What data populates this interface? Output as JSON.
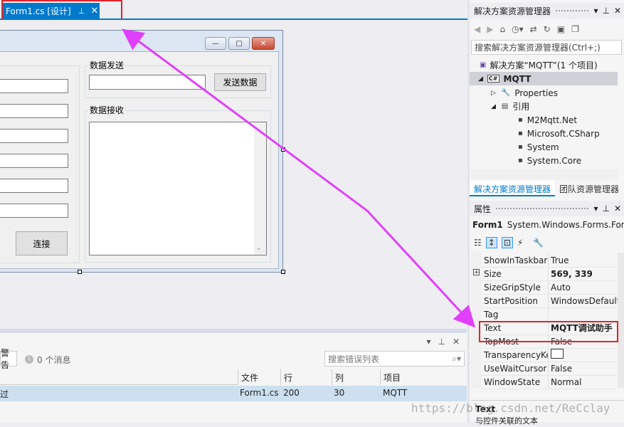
{
  "doc_tab": {
    "title": "Form1.cs [设计]",
    "pin": "⊥",
    "close": "✕"
  },
  "form_designer": {
    "groups": {
      "send": "数据发送",
      "receive": "数据接收"
    },
    "send_button": "发送数据",
    "connect_button": "连接",
    "caption_buttons": {
      "minimize": "—",
      "maximize": "□",
      "close": "✕"
    }
  },
  "solution_explorer": {
    "title": "解决方案资源管理器",
    "search_placeholder": "搜索解决方案资源管理器(Ctrl+;)",
    "solution": "解决方案“MQTT”(1 个项目)",
    "project": "MQTT",
    "project_badge": "C#",
    "items": [
      {
        "label": "Properties",
        "indent": 1
      },
      {
        "label": "引用",
        "indent": 1
      },
      {
        "label": "M2Mqtt.Net",
        "indent": 2
      },
      {
        "label": "Microsoft.CSharp",
        "indent": 2
      },
      {
        "label": "System",
        "indent": 2
      },
      {
        "label": "System.Core",
        "indent": 2
      }
    ],
    "tabs": [
      "解决方案资源管理器",
      "团队资源管理器"
    ]
  },
  "properties": {
    "title": "属性",
    "object_name": "Form1",
    "object_type": "System.Windows.Forms.For",
    "rows": [
      {
        "name": "ShowInTaskbar",
        "value": "True",
        "bold": false
      },
      {
        "name": "Size",
        "value": "569, 339",
        "bold": true
      },
      {
        "name": "SizeGripStyle",
        "value": "Auto",
        "bold": false
      },
      {
        "name": "StartPosition",
        "value": "WindowsDefault",
        "bold": false
      },
      {
        "name": "Tag",
        "value": "",
        "bold": false
      },
      {
        "name": "Text",
        "value": "MQTT调试助手",
        "bold": true
      },
      {
        "name": "TopMost",
        "value": "False",
        "bold": false
      },
      {
        "name": "TransparencyKe",
        "value": "",
        "bold": false
      },
      {
        "name": "UseWaitCursor",
        "value": "False",
        "bold": false
      },
      {
        "name": "WindowState",
        "value": "Normal",
        "bold": false
      }
    ],
    "desc_title": "Text",
    "desc_text": "与控件关联的文本"
  },
  "error_list": {
    "warnings_label": "警告",
    "messages_label": "0 个消息",
    "search_placeholder": "搜索错误列表",
    "columns": [
      "文件",
      "行",
      "列",
      "项目"
    ],
    "row": {
      "desc": "过",
      "file": "Form1.cs",
      "line": "200",
      "col": "30",
      "project": "MQTT"
    }
  },
  "watermark": "https://blog.csdn.net/ReCclay",
  "colors": {
    "accent": "#007acc",
    "annotation_red": "#e0242a",
    "annotation_arrow": "#e040fb"
  }
}
